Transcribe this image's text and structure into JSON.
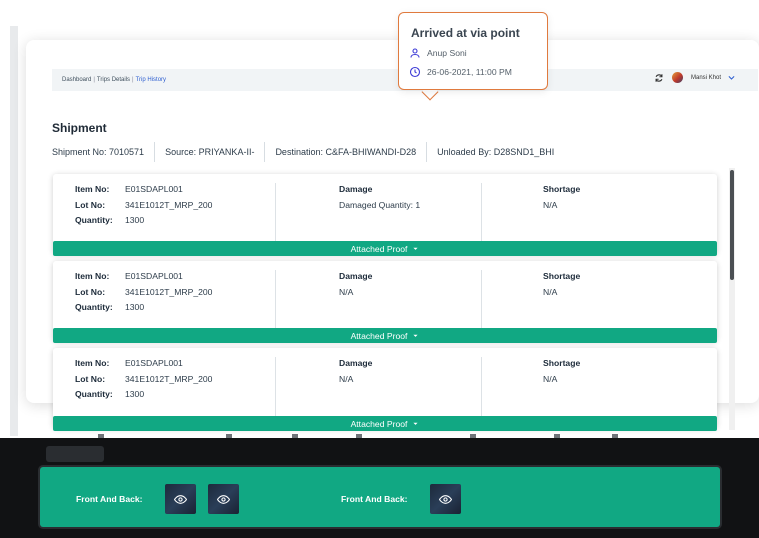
{
  "breadcrumb": {
    "items": [
      "Dashboard",
      "Trips Details",
      "Trip History"
    ],
    "separator": "|"
  },
  "user": {
    "name": "Mansi Khot"
  },
  "tooltip": {
    "title": "Arrived at via point",
    "person": "Anup Soni",
    "datetime": "26-06-2021, 11:00 PM"
  },
  "shipment": {
    "title": "Shipment",
    "shipment_no": "Shipment No: 7010571",
    "source": "Source: PRIYANKA-II-",
    "destination": "Destination: C&FA-BHIWANDI-D28",
    "unloaded_by": "Unloaded By: D28SND1_BHI"
  },
  "labels": {
    "item_no": "Item No:",
    "lot_no": "Lot No:",
    "quantity": "Quantity:",
    "damage": "Damage",
    "shortage": "Shortage",
    "attached_proof": "Attached Proof",
    "front_and_back": "Front And Back:"
  },
  "items": [
    {
      "item_no": "E01SDAPL001",
      "lot_no": "341E1012T_MRP_200",
      "quantity": "1300",
      "damage": "Damaged Quantity: 1",
      "shortage": "N/A"
    },
    {
      "item_no": "E01SDAPL001",
      "lot_no": "341E1012T_MRP_200",
      "quantity": "1300",
      "damage": "N/A",
      "shortage": "N/A"
    },
    {
      "item_no": "E01SDAPL001",
      "lot_no": "341E1012T_MRP_200",
      "quantity": "1300",
      "damage": "N/A",
      "shortage": "N/A"
    }
  ],
  "icons": {
    "refresh": "refresh-icon",
    "user": "user-icon",
    "clock": "clock-icon",
    "chevron": "chevron-down-icon",
    "caret": "caret-down-icon",
    "eye": "eye-icon"
  },
  "colors": {
    "accent_green": "#11a883",
    "tooltip_border": "#e07a3e",
    "link_blue": "#2f5fd0"
  }
}
